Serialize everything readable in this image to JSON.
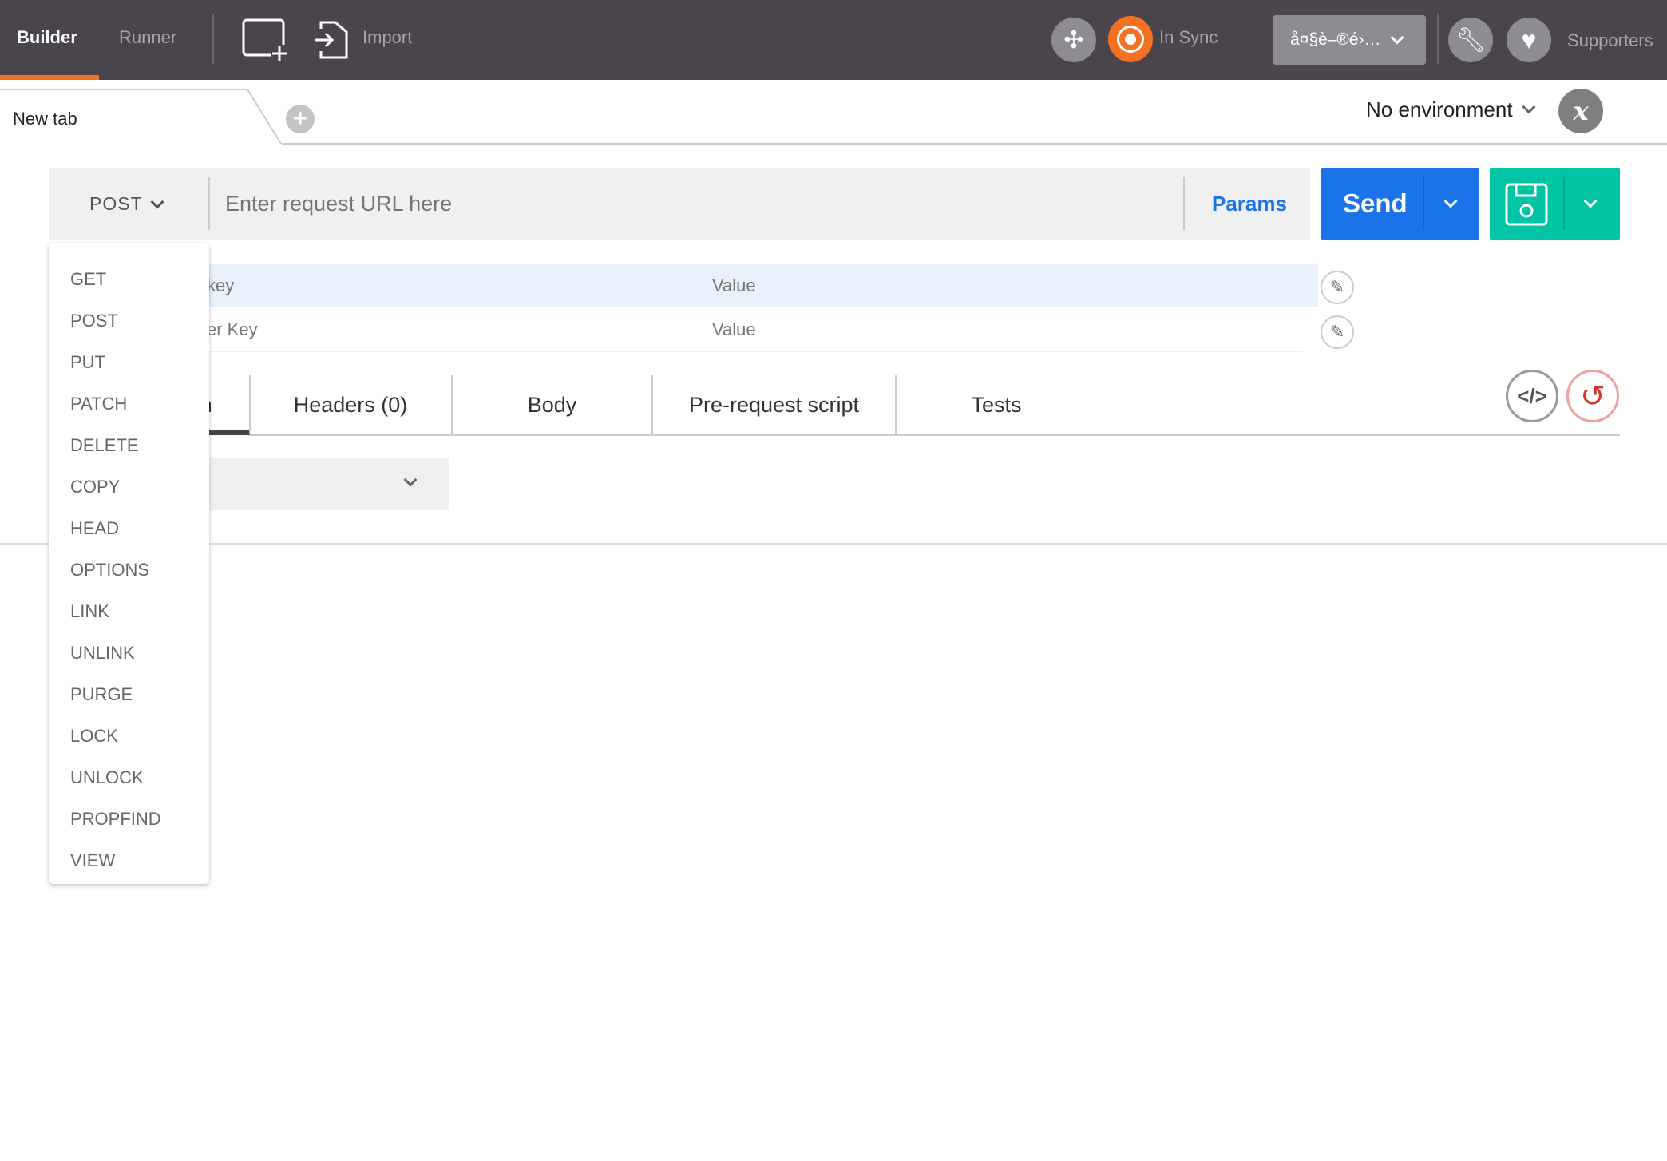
{
  "topbar": {
    "tabs": [
      {
        "label": "Builder",
        "active": true
      },
      {
        "label": "Runner",
        "active": false
      }
    ],
    "import_label": "Import",
    "sync_status": "In Sync",
    "workspace": "å¤§è–®é›…",
    "supporters_label": "Supporters",
    "accent": "#f47023"
  },
  "tabs": {
    "open": [
      {
        "label": "New tab"
      }
    ]
  },
  "environment": {
    "selected": "No environment"
  },
  "request": {
    "method": "POST",
    "url_placeholder": "Enter request URL here",
    "params_label": "Params",
    "send_label": "Send",
    "send_color": "#1a73e8",
    "save_color": "#00c4a4"
  },
  "params": {
    "rows": [
      {
        "key_placeholder": "key",
        "value_placeholder": "Value"
      },
      {
        "key_placeholder": "er Key",
        "value_placeholder": "Value"
      }
    ]
  },
  "request_tabs": [
    {
      "label": "Authorization",
      "active": true
    },
    {
      "label": "Headers (0)"
    },
    {
      "label": "Body"
    },
    {
      "label": "Pre-request script"
    },
    {
      "label": "Tests"
    }
  ],
  "method_menu": {
    "items": [
      "GET",
      "POST",
      "PUT",
      "PATCH",
      "DELETE",
      "COPY",
      "HEAD",
      "OPTIONS",
      "LINK",
      "UNLINK",
      "PURGE",
      "LOCK",
      "UNLOCK",
      "PROPFIND",
      "VIEW"
    ]
  }
}
